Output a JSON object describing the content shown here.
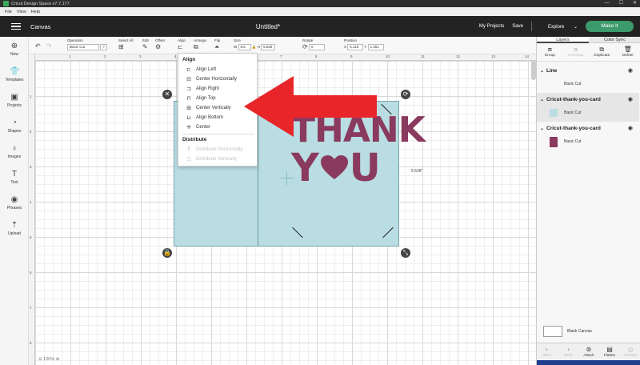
{
  "window": {
    "title": "Cricut Design Space  v7.7.177",
    "controls": [
      "—",
      "☐",
      "✕"
    ]
  },
  "menu": [
    "File",
    "View",
    "Help"
  ],
  "header": {
    "section": "Canvas",
    "doc_title": "Untitled*",
    "my_projects": "My Projects",
    "save": "Save",
    "explore": "Explore",
    "make_it": "Make It"
  },
  "leftbar": [
    {
      "label": "New",
      "icon": "plus-icon"
    },
    {
      "label": "Templates",
      "icon": "shirt-icon"
    },
    {
      "label": "Projects",
      "icon": "folder-icon"
    },
    {
      "label": "Shapes",
      "icon": "shapes-icon"
    },
    {
      "label": "Images",
      "icon": "bulb-icon"
    },
    {
      "label": "Text",
      "icon": "text-icon"
    },
    {
      "label": "Phrases",
      "icon": "chat-icon"
    },
    {
      "label": "Upload",
      "icon": "upload-icon"
    }
  ],
  "toolbar": {
    "operation_label": "Operation",
    "operation_value": "Basic Cut",
    "select_all": "Select All",
    "edit": "Edit",
    "offset": "Offset",
    "align": "Align",
    "arrange": "Arrange",
    "flip": "Flip",
    "size": "Size",
    "w_label": "W",
    "w_value": "8.5",
    "h_label": "H",
    "h_value": "5.528",
    "rotate": "Rotate",
    "rotate_value": "0",
    "position": "Position",
    "x_label": "X",
    "x_value": "5.118",
    "y_label": "Y",
    "y_value": "1.301"
  },
  "ruler_top": [
    "1",
    "2",
    "3",
    "4",
    "5",
    "6",
    "7",
    "8",
    "9",
    "10",
    "11",
    "12",
    "13",
    "14"
  ],
  "ruler_left": [
    "1",
    "2",
    "3",
    "4",
    "5",
    "6",
    "7",
    "8"
  ],
  "card": {
    "line1": "THANK",
    "line2_left": "Y",
    "line2_right": "U",
    "dim_height": "5.528\"",
    "card_color": "#b9dde2",
    "text_color": "#8a3a5e"
  },
  "align_menu": {
    "heading": "Align",
    "items": [
      {
        "label": "Align Left",
        "icon": "align-left-icon"
      },
      {
        "label": "Center Horizontally",
        "icon": "center-horizontal-icon"
      },
      {
        "label": "Align Right",
        "icon": "align-right-icon"
      },
      {
        "label": "Align Top",
        "icon": "align-top-icon"
      },
      {
        "label": "Center Vertically",
        "icon": "center-vertical-icon"
      },
      {
        "label": "Align Bottom",
        "icon": "align-bottom-icon"
      },
      {
        "label": "Center",
        "icon": "center-icon"
      }
    ],
    "distribute_heading": "Distribute",
    "distribute_items": [
      {
        "label": "Distribute Horizontally"
      },
      {
        "label": "Distribute Vertically"
      }
    ]
  },
  "arrow_color": "#e8262a",
  "layers_panel": {
    "tabs": [
      "Layers",
      "Color Sync"
    ],
    "actions": [
      {
        "label": "Group",
        "disabled": false
      },
      {
        "label": "UnGroup",
        "disabled": true
      },
      {
        "label": "Duplicate",
        "disabled": false
      },
      {
        "label": "Delete",
        "disabled": false
      }
    ],
    "layers": [
      {
        "name": "Line",
        "op": "Basic Cut",
        "color": ""
      },
      {
        "name": "Cricut-thank-you-card",
        "op": "Basic Cut",
        "color": "#b9dde2"
      },
      {
        "name": "Cricut-thank-you-card",
        "op": "Basic Cut",
        "color": "#8a3a5e"
      }
    ],
    "blank_canvas": "Blank Canvas",
    "bottom_actions": [
      {
        "label": "Slice",
        "disabled": true
      },
      {
        "label": "Weld",
        "disabled": true
      },
      {
        "label": "Attach",
        "disabled": false
      },
      {
        "label": "Flatten",
        "disabled": false
      },
      {
        "label": "Contour",
        "disabled": true
      }
    ]
  },
  "zoom": "100%"
}
